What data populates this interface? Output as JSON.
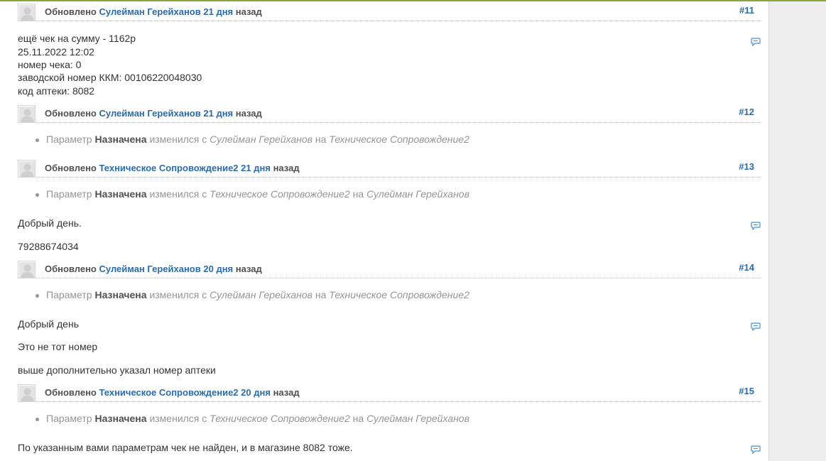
{
  "entries": [
    {
      "num": "#11",
      "updated": "Обновлено",
      "author": "Сулейман Герейханов",
      "age": "21 дня",
      "ago": "назад",
      "notes": [
        "ещё чек на сумму - 1162р",
        "25.11.2022 12:02",
        "номер чека: 0",
        "заводской номер ККМ: 00106220048030",
        "код аптеки: 8082"
      ]
    },
    {
      "num": "#12",
      "updated": "Обновлено",
      "author": "Сулейман Герейханов",
      "age": "21 дня",
      "ago": "назад",
      "detail": {
        "param_label": "Параметр",
        "param": "Назначена",
        "changed": "изменился с",
        "old": "Сулейман Герейханов",
        "to": "на",
        "new": "Техническое Сопровождение2"
      }
    },
    {
      "num": "#13",
      "updated": "Обновлено",
      "author": "Техническое Сопровождение2",
      "age": "21 дня",
      "ago": "назад",
      "detail": {
        "param_label": "Параметр",
        "param": "Назначена",
        "changed": "изменился с",
        "old": "Техническое Сопровождение2",
        "to": "на",
        "new": "Сулейман Герейханов"
      },
      "notes": [
        "Добрый день.",
        "79288674034"
      ]
    },
    {
      "num": "#14",
      "updated": "Обновлено",
      "author": "Сулейман Герейханов",
      "age": "20 дня",
      "ago": "назад",
      "detail": {
        "param_label": "Параметр",
        "param": "Назначена",
        "changed": "изменился с",
        "old": "Сулейман Герейханов",
        "to": "на",
        "new": "Техническое Сопровождение2"
      },
      "notes": [
        "Добрый день",
        "Это не тот номер",
        "выше дополнительно указал номер аптеки"
      ]
    },
    {
      "num": "#15",
      "updated": "Обновлено",
      "author": "Техническое Сопровождение2",
      "age": "20 дня",
      "ago": "назад",
      "detail": {
        "param_label": "Параметр",
        "param": "Назначена",
        "changed": "изменился с",
        "old": "Техническое Сопровождение2",
        "to": "на",
        "new": "Сулейман Герейханов"
      },
      "notes": [
        "По указанным вами параметрам чек не найден, и в магазине 8082 тоже."
      ]
    }
  ],
  "colors": {
    "accent": "#8aa63c",
    "link": "#2a6cab",
    "muted": "#959595"
  },
  "icons": {
    "avatar": "user-avatar-placeholder",
    "reply": "speech-bubble-icon"
  }
}
